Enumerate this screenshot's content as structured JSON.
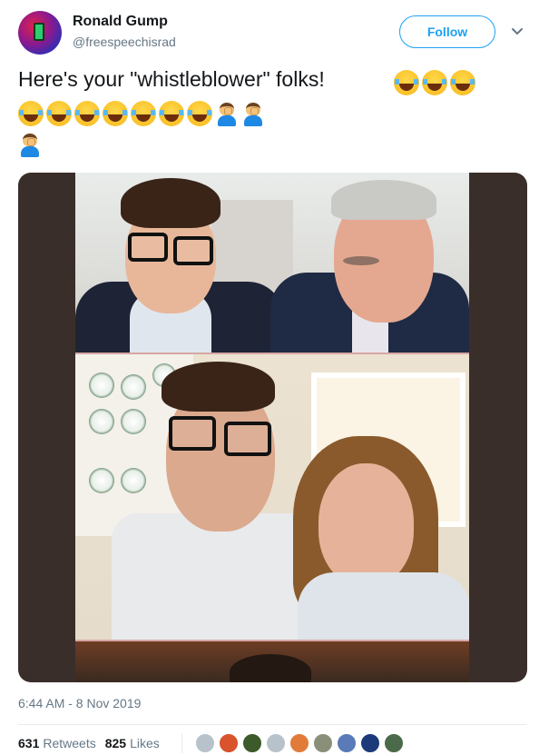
{
  "user": {
    "name": "Ronald Gump",
    "handle": "@freespeechisrad",
    "follow_label": "Follow"
  },
  "tweet": {
    "text": "Here's your \"whistleblower\" folks!",
    "emoji_line1": [
      "joy-emoji",
      "joy-emoji",
      "joy-emoji"
    ],
    "emoji_line2": [
      "joy-emoji",
      "joy-emoji",
      "joy-emoji",
      "joy-emoji",
      "joy-emoji",
      "joy-emoji",
      "joy-emoji",
      "facepalm-emoji",
      "facepalm-emoji"
    ],
    "emoji_line3": [
      "facepalm-emoji"
    ]
  },
  "meta": {
    "timestamp": "6:44 AM - 8 Nov 2019",
    "retweets_count": "631",
    "retweets_label": "Retweets",
    "likes_count": "825",
    "likes_label": "Likes"
  },
  "colors": {
    "accent": "#1da1f2",
    "secondary_text": "#657786",
    "primary_text": "#14171a"
  },
  "likers": [
    "#b8c2cb",
    "#d9532c",
    "#3d5a2a",
    "#b8c2cb",
    "#e07b3a",
    "#8a8f7a",
    "#5a7ab8",
    "#1c3a7a",
    "#4a6a4a"
  ]
}
